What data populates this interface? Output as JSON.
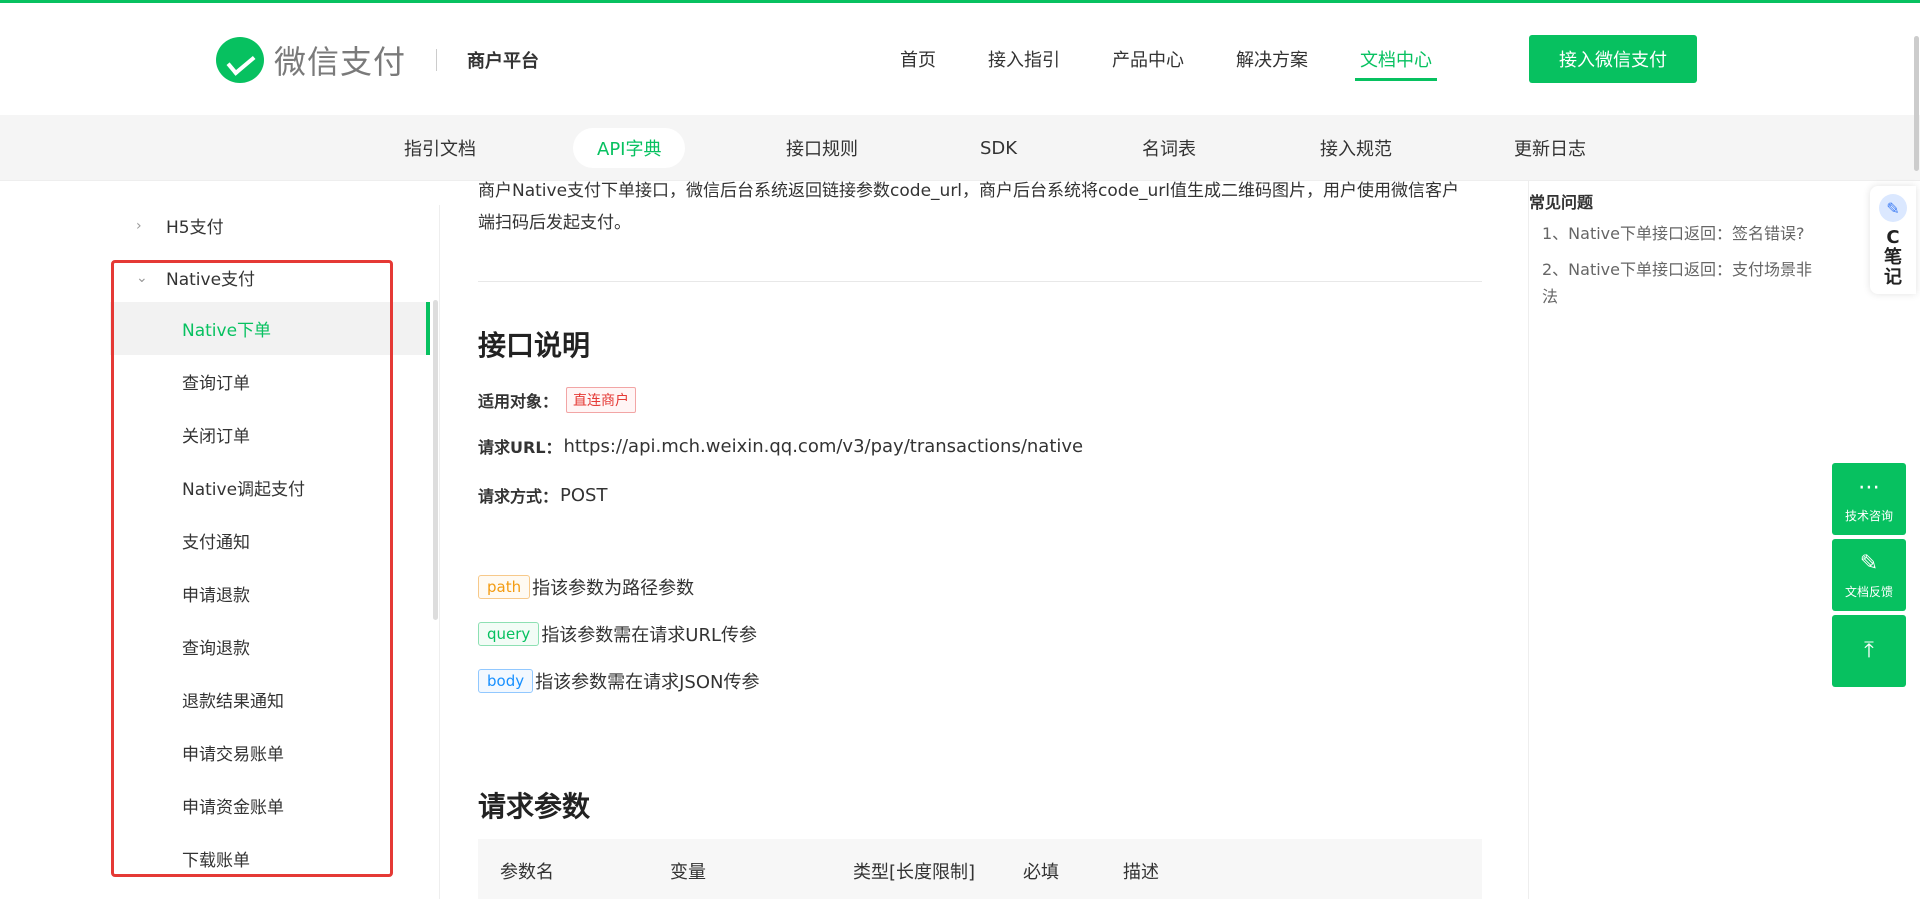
{
  "header": {
    "logo_text": "微信支付",
    "logo_sub": "商户平台",
    "nav": [
      "首页",
      "接入指引",
      "产品中心",
      "解决方案",
      "文档中心"
    ],
    "cta": "接入微信支付"
  },
  "subnav": [
    "指引文档",
    "API字典",
    "接口规则",
    "SDK",
    "名词表",
    "接入规范",
    "更新日志"
  ],
  "sidebar": {
    "group_h5": "H5支付",
    "group_native": "Native支付",
    "items": [
      "Native下单",
      "查询订单",
      "关闭订单",
      "Native调起支付",
      "支付通知",
      "申请退款",
      "查询退款",
      "退款结果通知",
      "申请交易账单",
      "申请资金账单",
      "下载账单"
    ]
  },
  "main": {
    "intro_line1": "商户Native支付下单接口，微信后台系统返回链接参数code_url，商户后台系统将code_url值生成二维码图片，用户使用微信客户",
    "intro_line2": "端扫码后发起支付。",
    "section1_title": "接口说明",
    "target_label": "适用对象：",
    "target_tag": "直连商户",
    "url_label": "请求URL：",
    "url_value": "https://api.mch.weixin.qq.com/v3/pay/transactions/native",
    "method_label": "请求方式：",
    "method_value": "POST",
    "param_tags": [
      {
        "tag": "path",
        "text": "指该参数为路径参数"
      },
      {
        "tag": "query",
        "text": "指该参数需在请求URL传参"
      },
      {
        "tag": "body",
        "text": "指该参数需在请求JSON传参"
      }
    ],
    "section2_title": "请求参数",
    "table_headers": [
      "参数名",
      "变量",
      "类型[长度限制]",
      "必填",
      "描述"
    ]
  },
  "faq": {
    "title": "常见问题",
    "items": [
      "1、Native下单接口返回：签名错误?",
      "2、Native下单接口返回：支付场景非法"
    ]
  },
  "float_tools": {
    "note_text": "C笔记",
    "consult": "技术咨询",
    "feedback": "文档反馈"
  },
  "colors": {
    "brand": "#07c160",
    "highlight_box": "#e53935"
  }
}
